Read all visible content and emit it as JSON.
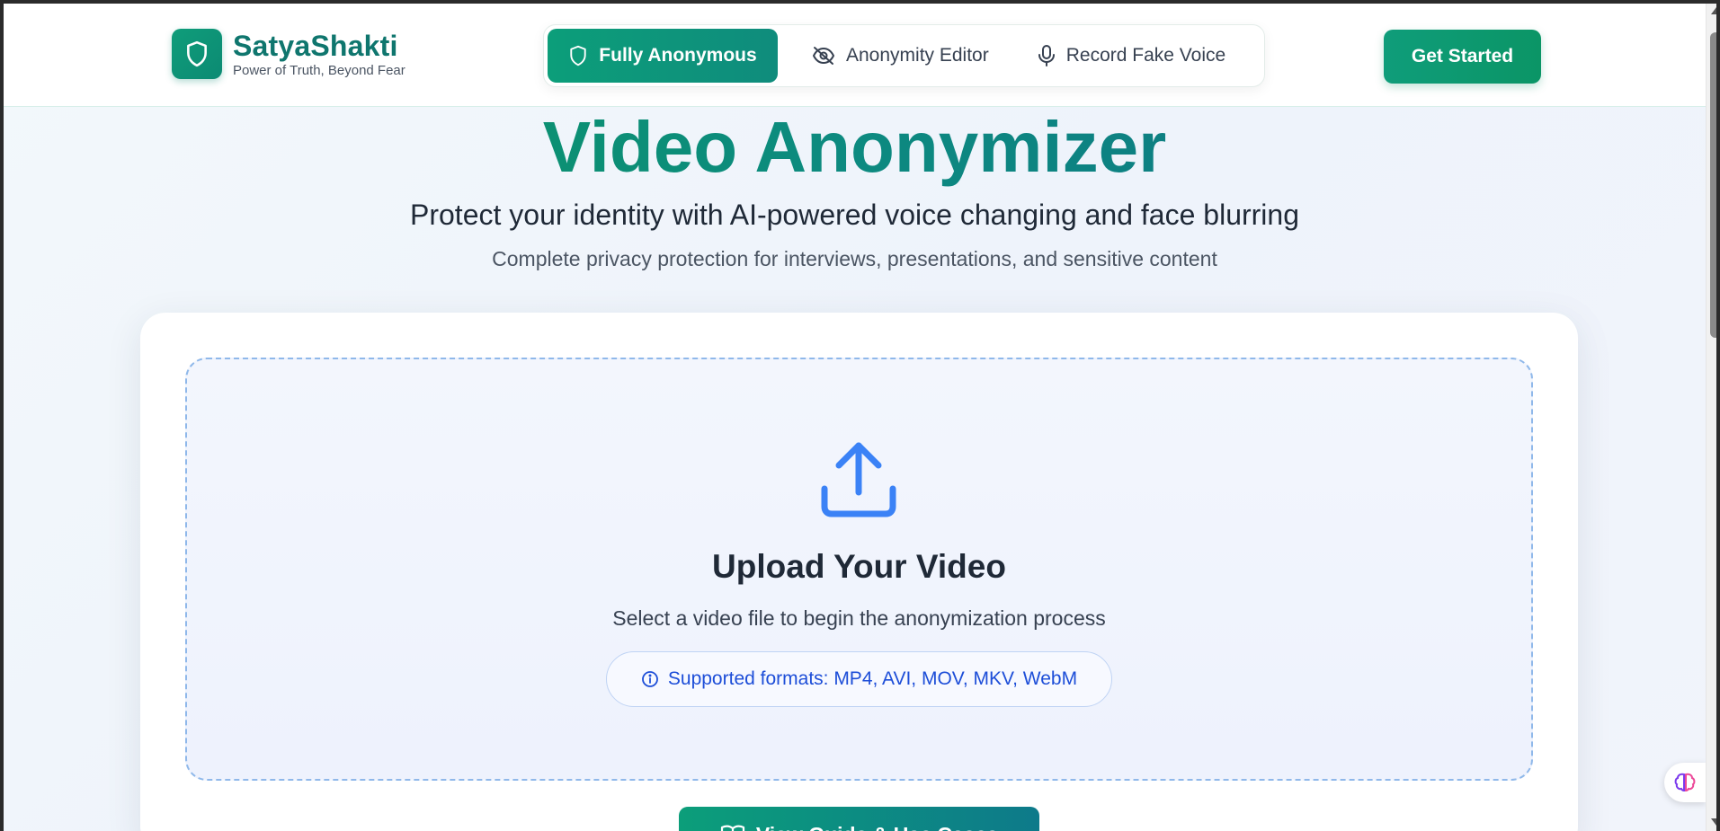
{
  "header": {
    "brand_name": "SatyaShakti",
    "brand_tagline": "Power of Truth, Beyond Fear",
    "nav": [
      {
        "label": "Fully Anonymous",
        "icon": "shield-icon",
        "active": true
      },
      {
        "label": "Anonymity Editor",
        "icon": "eye-off-icon",
        "active": false
      },
      {
        "label": "Record Fake Voice",
        "icon": "microphone-icon",
        "active": false
      }
    ],
    "cta_label": "Get Started"
  },
  "hero": {
    "title": "Video Anonymizer",
    "subtitle": "Protect your identity with AI-powered voice changing and face blurring",
    "description": "Complete privacy protection for interviews, presentations, and sensitive content"
  },
  "upload": {
    "icon": "upload-icon",
    "title": "Upload Your Video",
    "description": "Select a video file to begin the anonymization process",
    "formats": "Supported formats: MP4, AVI, MOV, MKV, WebM"
  },
  "guide_button_label": "View Guide & Use Cases",
  "colors": {
    "brand_green": "#0f9d7a",
    "brand_teal": "#0f766e",
    "upload_blue": "#3b82f6",
    "format_text": "#1d4ed8"
  }
}
